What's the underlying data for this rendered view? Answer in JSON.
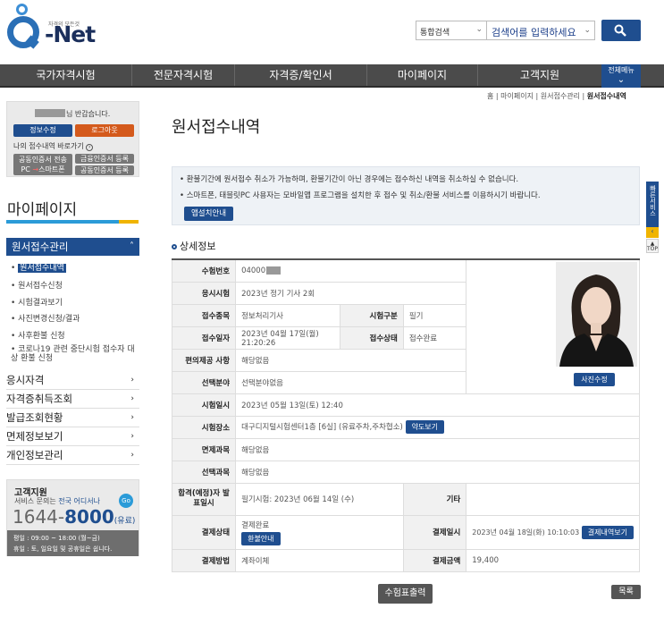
{
  "brand": {
    "tagline": "자격의 모든것",
    "name": "-Net"
  },
  "search": {
    "scope": "통합검색",
    "placeholder": "검색어를 입력하세요"
  },
  "gnb": [
    {
      "label": "국가자격시험"
    },
    {
      "label": "전문자격시험"
    },
    {
      "label": "자격증/확인서"
    },
    {
      "label": "마이페이지"
    },
    {
      "label": "고객지원"
    }
  ],
  "allmenu": {
    "label": "전체메뉴"
  },
  "user": {
    "greeting": "님 반갑습니다.",
    "edit_label": "정보수정",
    "logout_label": "로그아웃",
    "shortcut_label": "나의 접수내역 바로가기",
    "cert_send": "공동인증서 전송",
    "cert_pc_prefix": "PC",
    "cert_pc_suffix": "스마트폰",
    "fin_cert": "금융인증서 등록",
    "joint_cert": "공동인증서 등록"
  },
  "sidebar": {
    "title": "마이페이지",
    "active": "원서접수관리",
    "submenu": [
      "원서접수내역",
      "원서접수신청",
      "시험결과보기",
      "사진변경신청/결과",
      "사후환불 신청",
      "코로나19 관련 중단시험 접수자 대상 환불 신청"
    ],
    "menus": [
      "응시자격",
      "자격증취득조회",
      "발급조회현황",
      "면제정보보기",
      "개인정보관리"
    ]
  },
  "support": {
    "title": "고객지원",
    "desc_prefix": "서비스 문의는",
    "desc_em": "전국 어디서나",
    "go": "Go",
    "phone_a": "1644",
    "phone_sep": "-",
    "phone_b": "8000",
    "phone_paid": "(유료)",
    "hours1": "평일 : 09:00 ~ 18:00 (월~금)",
    "hours2": "휴일 : 토, 일요일 및 공휴일은 쉽니다."
  },
  "breadcrumb": {
    "home": "홈",
    "mypage": "마이페이지",
    "manage": "원서접수관리",
    "current": "원서접수내역"
  },
  "page_title": "원서접수내역",
  "notice": {
    "line1": "환불기간에 원서접수 취소가 가능하며, 환불기간이 아닌 경우에는 접수하신 내역을 취소하실 수 없습니다.",
    "line2": "스마트폰, 태블릿PC 사용자는 모바일앱 프로그램을 설치한 후 접수 및 취소/환불 서비스를 이용하시기 바랍니다.",
    "button": "앱설치안내"
  },
  "detail": {
    "heading": "상세정보",
    "exam_no_label": "수험번호",
    "exam_no": "04000",
    "exam_label": "응시시험",
    "exam": "2023년 정기 기사 2회",
    "category_label": "접수종목",
    "category": "정보처리기사",
    "exam_type_label": "시험구분",
    "exam_type": "필기",
    "apply_date_label": "접수일자",
    "apply_date": "2023년 04월 17일(월) 21:20:26",
    "apply_status_label": "접수상태",
    "apply_status": "접수완료",
    "convenience_label": "편의제공 사항",
    "convenience": "해당없음",
    "field_label": "선택분야",
    "field": "선택분야없음",
    "exam_date_label": "시험일시",
    "exam_date": "2023년 05월 13일(토) 12:40",
    "place_label": "시험장소",
    "place": "대구디지털시험센터1층 [6실] (유료주차,주차협소)",
    "map_btn": "약도보기",
    "exempt_label": "면제과목",
    "exempt": "해당없음",
    "elective_label": "선택과목",
    "elective": "해당없음",
    "announce_label": "합격(예정)자 발표일시",
    "announce": "필기시험: 2023년 06월 14일 (수)",
    "etc_label": "기타",
    "etc": "",
    "pay_status_label": "결제상태",
    "pay_status": "결제완료",
    "refund_btn": "환불안내",
    "pay_date_label": "결제일시",
    "pay_date": "2023년 04월 18일(화) 10:10:03",
    "pay_detail_btn": "결제내역보기",
    "pay_method_label": "결제방법",
    "pay_method": "계좌이체",
    "amount_label": "결제금액",
    "amount": "19,400",
    "photo_edit": "사진수정"
  },
  "actions": {
    "print": "수험표출력",
    "list": "목록"
  },
  "quick": {
    "label": "빠른서비스",
    "top": "TOP"
  }
}
